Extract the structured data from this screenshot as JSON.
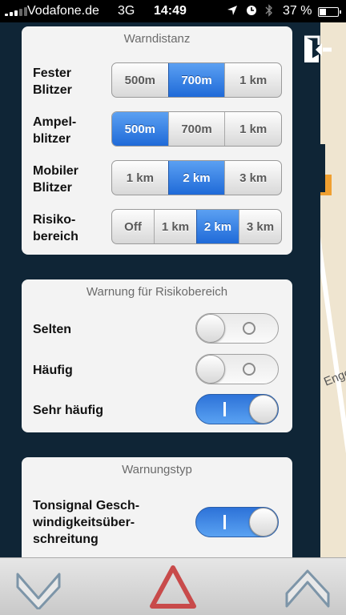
{
  "status_bar": {
    "carrier": "Vodafone.de",
    "network": "3G",
    "time": "14:49",
    "battery": "37 %",
    "battery_level": 0.37,
    "icons": [
      "location-arrow-icon",
      "clock-icon",
      "bluetooth-icon"
    ]
  },
  "warndistanz": {
    "title": "Warndistanz",
    "rows": [
      {
        "label1": "Fester",
        "label2": "Blitzer",
        "options": [
          "500m",
          "700m",
          "1 km"
        ],
        "selected": 1
      },
      {
        "label1": "Ampel-",
        "label2": "blitzer",
        "options": [
          "500m",
          "700m",
          "1 km"
        ],
        "selected": 0
      },
      {
        "label1": "Mobiler",
        "label2": "Blitzer",
        "options": [
          "1 km",
          "2 km",
          "3 km"
        ],
        "selected": 1
      },
      {
        "label1": "Risiko-",
        "label2": "bereich",
        "options": [
          "Off",
          "1 km",
          "2 km",
          "3 km"
        ],
        "selected": 2
      }
    ]
  },
  "risikobereich": {
    "title": "Warnung für Risikobereich",
    "items": [
      {
        "label": "Selten",
        "on": false
      },
      {
        "label": "Häufig",
        "on": false
      },
      {
        "label": "Sehr häufig",
        "on": true
      }
    ]
  },
  "warnungstyp": {
    "title": "Warnungstyp",
    "item": {
      "line1": "Tonsignal Gesch-",
      "line2": "windigkeitsüber-",
      "line3": "schreitung",
      "on": true
    }
  },
  "map": {
    "street_fragment": "Engel"
  },
  "colors": {
    "accent": "#2f7be0",
    "panel": "#0f2536",
    "warning": "#c84a4a"
  }
}
